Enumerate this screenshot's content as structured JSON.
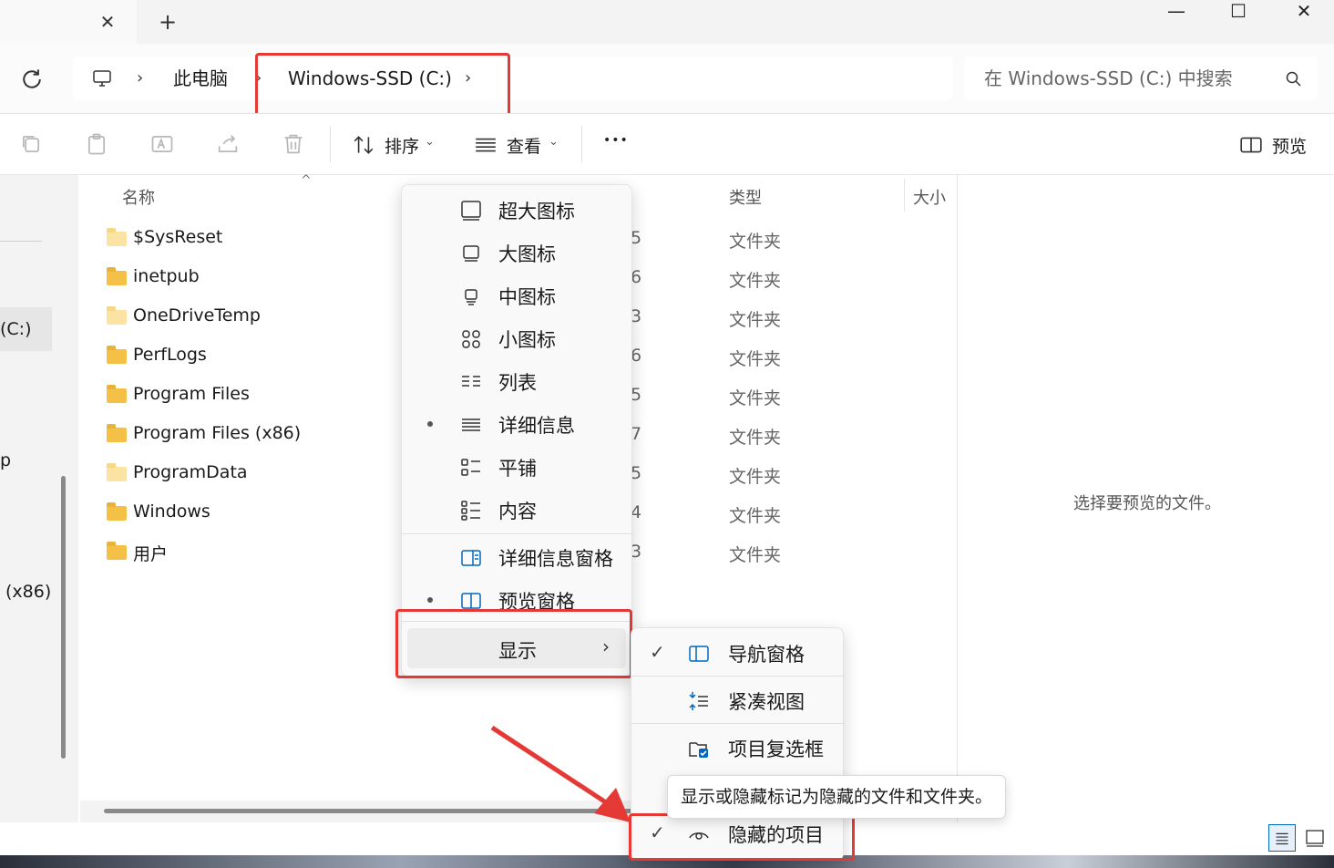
{
  "titlebar": {
    "tab_close": "✕",
    "new_tab": "+",
    "minimize": "—",
    "maximize": "☐",
    "close": "✕"
  },
  "address": {
    "crumbs": [
      "此电脑",
      "Windows-SSD (C:)"
    ],
    "search_placeholder": "在 Windows-SSD (C:) 中搜索"
  },
  "toolbar": {
    "sort_label": "排序",
    "view_label": "查看",
    "more_label": "•••",
    "preview_label": "预览"
  },
  "sidebar": {
    "selected_item": "(C:)",
    "item_p": "p",
    "item_x86": "(x86)"
  },
  "columns": {
    "name": "名称",
    "type": "类型",
    "size": "大小"
  },
  "files": [
    {
      "name": "$SysReset",
      "date_tail": "5",
      "type": "文件夹"
    },
    {
      "name": "inetpub",
      "date_tail": "6",
      "type": "文件夹"
    },
    {
      "name": "OneDriveTemp",
      "date_tail": "3",
      "type": "文件夹"
    },
    {
      "name": "PerfLogs",
      "date_tail": "6",
      "type": "文件夹"
    },
    {
      "name": "Program Files",
      "date_tail": "5",
      "type": "文件夹"
    },
    {
      "name": "Program Files (x86)",
      "date_tail": "7",
      "type": "文件夹"
    },
    {
      "name": "ProgramData",
      "date_tail": "5",
      "type": "文件夹"
    },
    {
      "name": "Windows",
      "date_tail": "4",
      "type": "文件夹"
    },
    {
      "name": "用户",
      "date_tail": "3",
      "type": "文件夹"
    }
  ],
  "preview_empty": "选择要预览的文件。",
  "view_menu": {
    "items": [
      "超大图标",
      "大图标",
      "中图标",
      "小图标",
      "列表",
      "详细信息",
      "平铺",
      "内容",
      "详细信息窗格",
      "预览窗格"
    ],
    "show": "显示"
  },
  "show_submenu": {
    "items": [
      "导航窗格",
      "紧凑视图",
      "项目复选框",
      "隐藏的项目"
    ]
  },
  "tooltip": "显示或隐藏标记为隐藏的文件和文件夹。",
  "colors": {
    "highlight": "#e53935",
    "accent": "#0067c0",
    "folder": "#f4c046"
  }
}
